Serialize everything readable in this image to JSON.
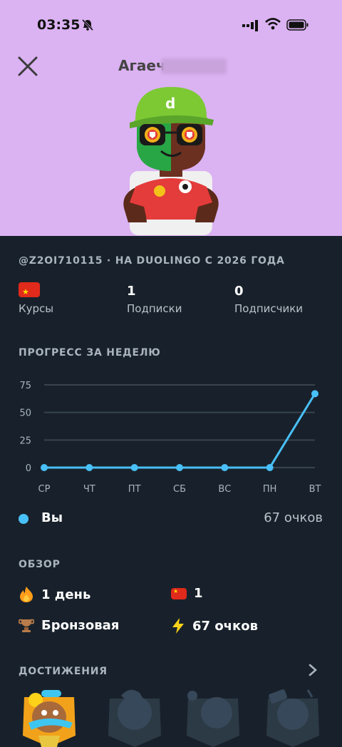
{
  "status_bar": {
    "time": "03:35"
  },
  "header": {
    "name": "Агаеч"
  },
  "profile": {
    "handle": "@Z2OI710115 · НА DUOLINGO С 2026 ГОДА",
    "stats": [
      {
        "value": "",
        "label": "Курсы"
      },
      {
        "value": "1",
        "label": "Подписки"
      },
      {
        "value": "0",
        "label": "Подписчики"
      }
    ]
  },
  "progress": {
    "title": "ПРОГРЕСС ЗА НЕДЕЛЮ",
    "legend": {
      "label": "Вы",
      "value": "67 очков"
    }
  },
  "chart_data": {
    "type": "line",
    "categories": [
      "СР",
      "ЧТ",
      "ПТ",
      "СБ",
      "ВС",
      "ПН",
      "ВТ"
    ],
    "series": [
      {
        "name": "Вы",
        "values": [
          0,
          0,
          0,
          0,
          0,
          0,
          67
        ],
        "color": "#49c0f8"
      }
    ],
    "yticks": [
      "0",
      "25",
      "50",
      "75"
    ],
    "ylim": [
      0,
      75
    ],
    "grid": true
  },
  "overview": {
    "title": "ОБЗОР",
    "items": [
      {
        "icon": "flame-icon",
        "text": "1 день"
      },
      {
        "icon": "china-flag-icon",
        "text": "1"
      },
      {
        "icon": "bronze-league-icon",
        "text": "Бронзовая"
      },
      {
        "icon": "lightning-icon",
        "text": "67 очков"
      }
    ]
  },
  "achievements": {
    "title": "ДОСТИЖЕНИЯ"
  },
  "colors": {
    "accent": "#49c0f8",
    "header_bg": "#dbb2f2",
    "page_bg": "#18212b"
  }
}
